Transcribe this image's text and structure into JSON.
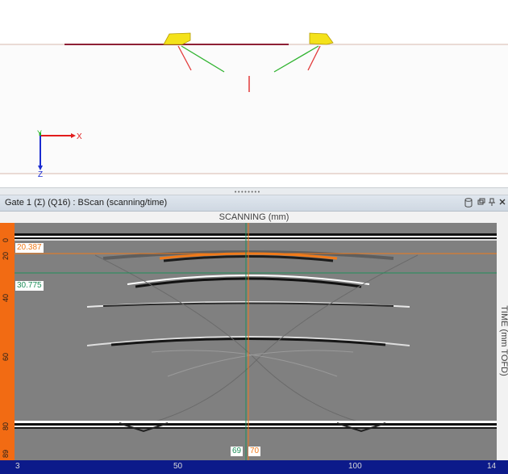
{
  "panel": {
    "title": "Gate 1 (Σ) (Q16) : BScan (scanning/time)",
    "icons": [
      "database-icon",
      "restore-icon",
      "pin-icon",
      "close-icon"
    ]
  },
  "axes3d": {
    "x_label": "X",
    "y_label": "Y",
    "z_label": "Z"
  },
  "bscan": {
    "x_axis_title": "SCANNING (mm)",
    "y_axis_title": "TIME (mm TOFD)",
    "y_ticks": [
      "0",
      "20",
      "40",
      "60",
      "80",
      "89"
    ],
    "x_ticks": [
      "3",
      "50",
      "100",
      "14"
    ],
    "cursor_orange_value": "20.387",
    "cursor_green_value": "30.775",
    "cursor_green_x": "69",
    "cursor_orange_x": "70",
    "colors": {
      "ruler_vertical": "#f26b13",
      "ruler_horizontal": "#0c1a8a",
      "cursor_orange": "#f07a1a",
      "cursor_green": "#1f8f5a",
      "background_gray": "#7f7f7f"
    }
  }
}
